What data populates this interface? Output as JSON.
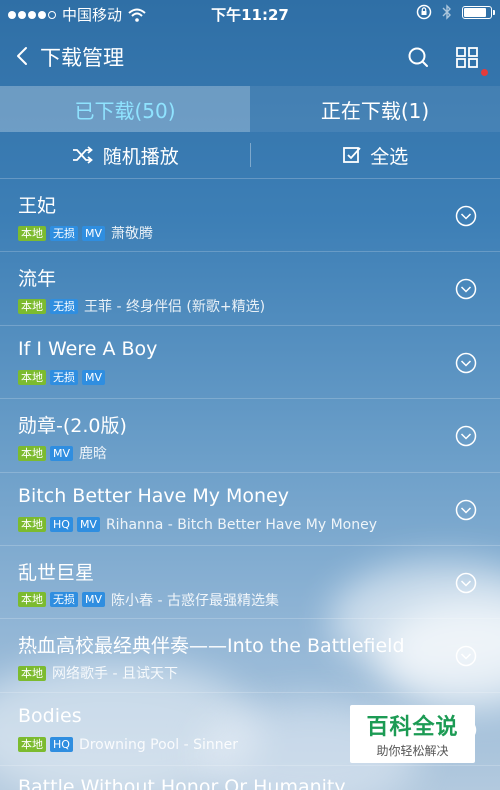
{
  "status_bar": {
    "carrier": "中国移动",
    "time": "下午11:27",
    "signal_level": 4,
    "battery_level": 0.9
  },
  "nav": {
    "title": "下载管理",
    "has_notification_dot": true
  },
  "tabs": [
    {
      "label": "已下载(50)",
      "active": true
    },
    {
      "label": "正在下载(1)",
      "active": false
    }
  ],
  "actions": {
    "shuffle_label": "随机播放",
    "select_all_label": "全选"
  },
  "songs": [
    {
      "title": "王妃",
      "tags": [
        "本地",
        "无损",
        "MV"
      ],
      "meta": "萧敬腾"
    },
    {
      "title": "流年",
      "tags": [
        "本地",
        "无损"
      ],
      "meta": "王菲 - 终身伴侣 (新歌+精选)"
    },
    {
      "title": "If I Were A Boy",
      "tags": [
        "本地",
        "无损",
        "MV"
      ],
      "meta": ""
    },
    {
      "title": "勋章-(2.0版)",
      "tags": [
        "本地",
        "MV"
      ],
      "meta": "鹿晗"
    },
    {
      "title": "Bitch Better Have My Money",
      "tags": [
        "本地",
        "HQ",
        "MV"
      ],
      "meta": "Rihanna - Bitch Better Have My Money"
    },
    {
      "title": "乱世巨星",
      "tags": [
        "本地",
        "无损",
        "MV"
      ],
      "meta": "陈小春 - 古惑仔最强精选集"
    },
    {
      "title": "热血高校最经典伴奏——Into the Battlefield",
      "tags": [
        "本地"
      ],
      "meta": "网络歌手 - 且试天下"
    },
    {
      "title": "Bodies",
      "tags": [
        "本地",
        "HQ"
      ],
      "meta": "Drowning Pool - Sinner"
    }
  ],
  "partial_row_title": "Battle Without Honor Or Humanity",
  "watermark": {
    "title": "百科全说",
    "subtitle": "助你轻松解决"
  },
  "colors": {
    "active_tab_text": "#8fe3ff",
    "tag_local": "#7cbb2f",
    "tag_quality": "#2f8ee0",
    "notification_dot": "#e43b3b",
    "watermark_green": "#1c9b54"
  }
}
